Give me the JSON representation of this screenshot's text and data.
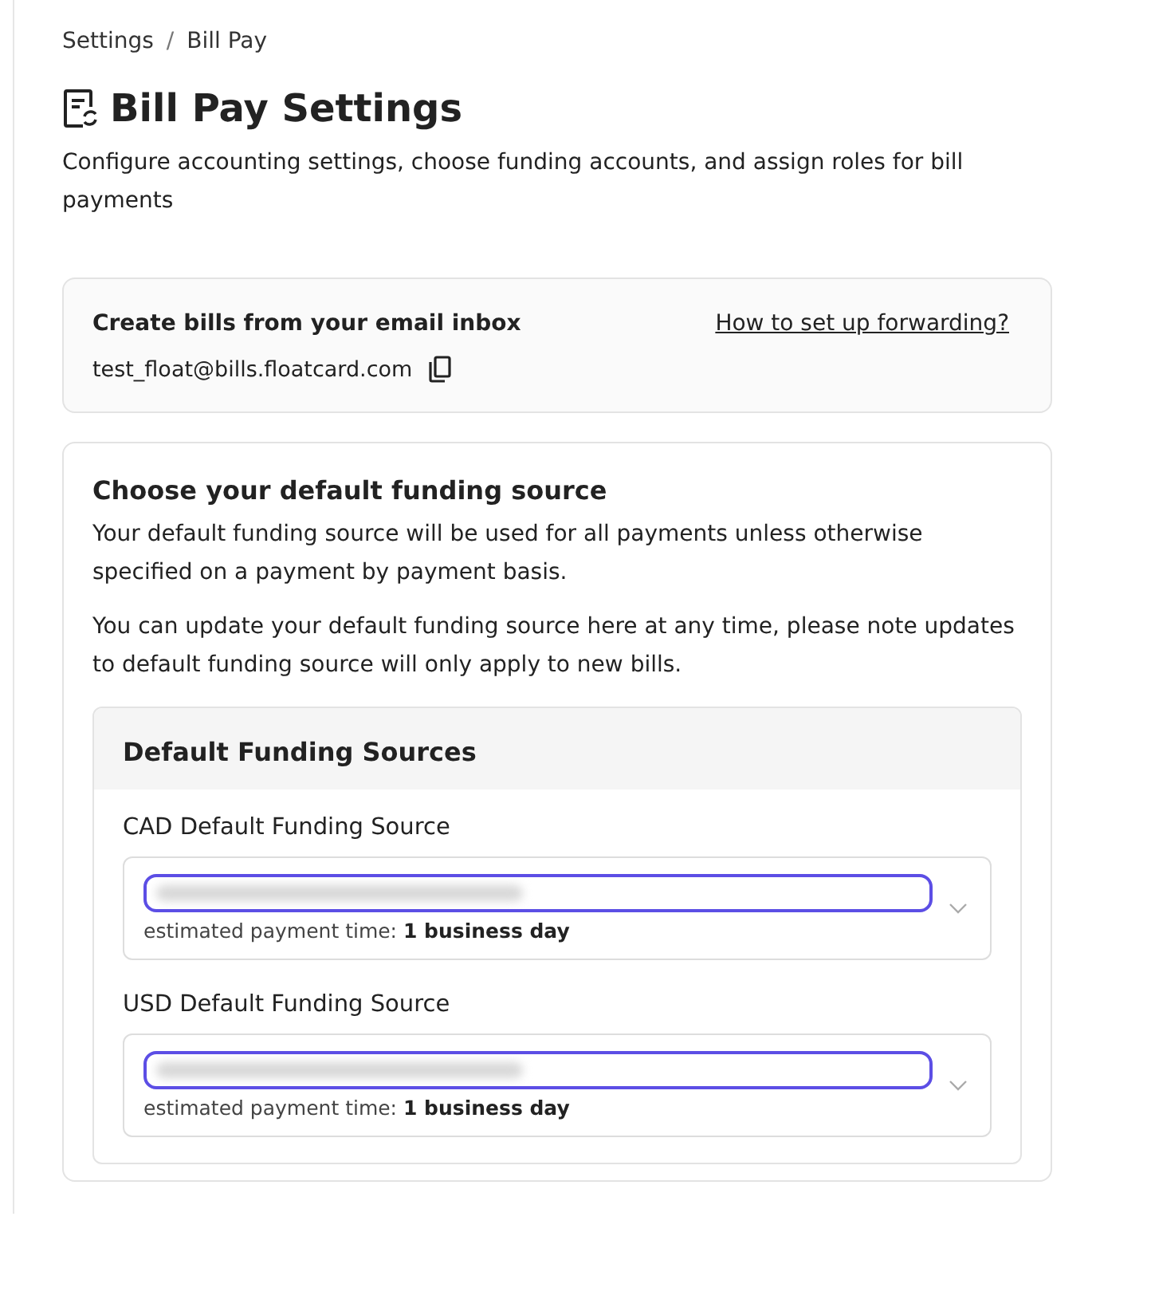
{
  "breadcrumb": {
    "items": [
      "Settings",
      "Bill Pay"
    ],
    "separator": "/"
  },
  "header": {
    "title": "Bill Pay Settings",
    "description": "Configure accounting settings, choose funding accounts, and assign roles for bill payments"
  },
  "email_card": {
    "title": "Create bills from your email inbox",
    "email": "test_float@bills.floatcard.com",
    "link": "How to set up forwarding?"
  },
  "funding_card": {
    "title": "Choose your default funding source",
    "paragraphs": [
      "Your default funding source will be used for all payments unless otherwise specified on a payment by payment basis.",
      "You can update your default funding source here at any time, please note updates to default funding source will only apply to new bills."
    ],
    "panel": {
      "title": "Default Funding Sources",
      "fields": [
        {
          "label": "CAD Default Funding Source",
          "hint": "estimated payment time: **1 business day**"
        },
        {
          "label": "USD Default Funding Source",
          "hint": "estimated payment time: **1 business day**"
        }
      ]
    }
  }
}
